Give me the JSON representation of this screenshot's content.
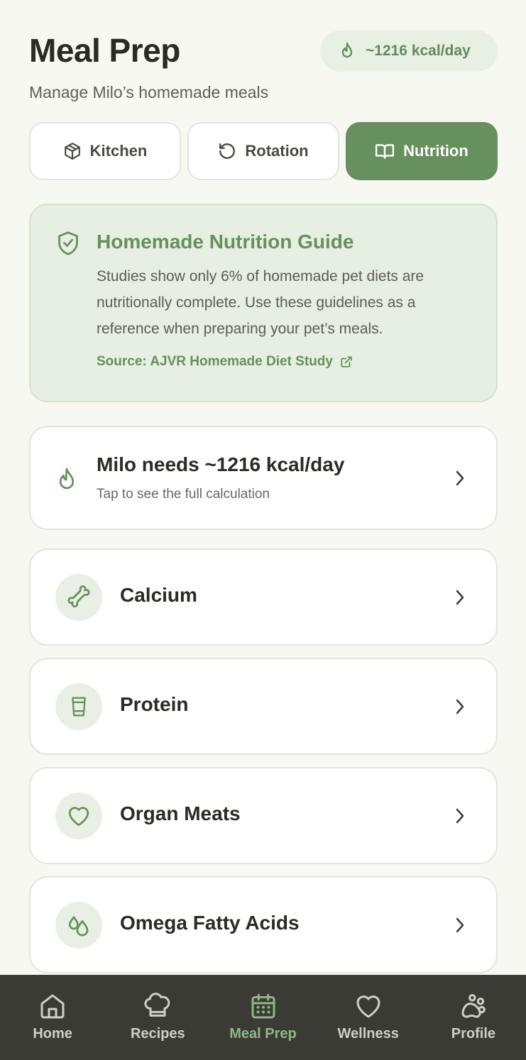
{
  "header": {
    "title": "Meal Prep",
    "subtitle": "Manage Milo’s homemade meals",
    "kcal_badge": "~1216 kcal/day",
    "kcal_icon": "flame-icon"
  },
  "tabs": [
    {
      "label": "Kitchen",
      "icon": "package-icon",
      "active": false
    },
    {
      "label": "Rotation",
      "icon": "rotate-icon",
      "active": false
    },
    {
      "label": "Nutrition",
      "icon": "book-open-icon",
      "active": true
    }
  ],
  "guide": {
    "icon": "shield-check-icon",
    "title": "Homemade Nutrition Guide",
    "body": "Studies show only 6% of homemade pet diets are nutritionally complete. Use these guidelines as a reference when preparing your pet’s meals.",
    "source_label": "Source: AJVR Homemade Diet Study",
    "source_icon": "external-link-icon"
  },
  "needs": {
    "icon": "flame-icon",
    "title": "Milo needs ~1216 kcal/day",
    "subtitle": "Tap to see the full calculation"
  },
  "nutrients": [
    {
      "label": "Calcium",
      "icon": "bone-icon"
    },
    {
      "label": "Protein",
      "icon": "cup-icon"
    },
    {
      "label": "Organ Meats",
      "icon": "heart-icon"
    },
    {
      "label": "Omega Fatty Acids",
      "icon": "droplets-icon"
    }
  ],
  "nav": [
    {
      "label": "Home",
      "icon": "home-icon",
      "active": false
    },
    {
      "label": "Recipes",
      "icon": "chef-hat-icon",
      "active": false
    },
    {
      "label": "Meal Prep",
      "icon": "calendar-icon",
      "active": true
    },
    {
      "label": "Wellness",
      "icon": "heart-icon",
      "active": false
    },
    {
      "label": "Profile",
      "icon": "paw-icon",
      "active": false
    }
  ],
  "colors": {
    "accent": "#66905e",
    "background": "#f8f8f3",
    "guide_bg": "#e6efe1",
    "nav_bg": "#3b3b36",
    "nav_active": "#8fb784"
  }
}
